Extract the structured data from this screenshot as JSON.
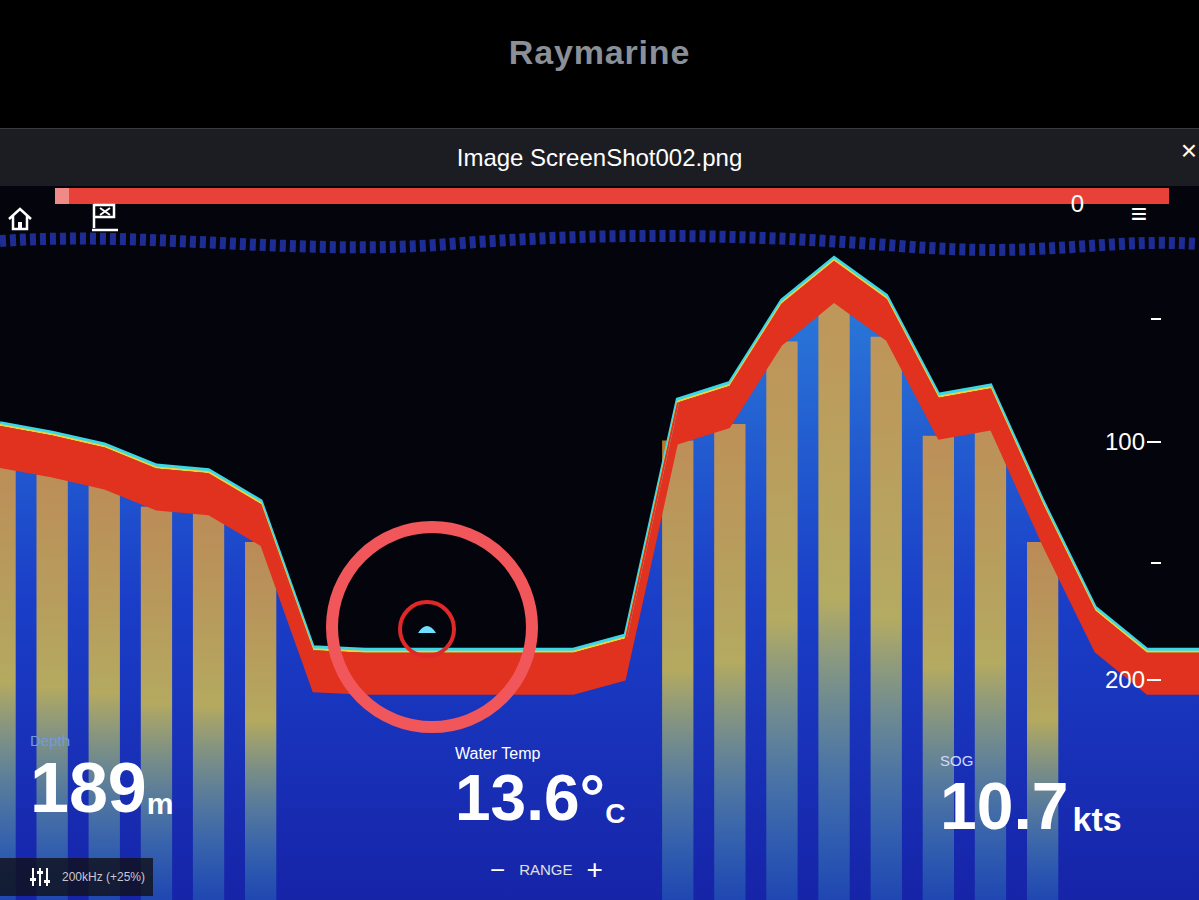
{
  "device": {
    "brand": "Raymarine"
  },
  "window": {
    "title": "Image ScreenShot002.png",
    "close": "×"
  },
  "toolbar": {
    "menu": "≡"
  },
  "sonar": {
    "scale": {
      "ticks": [
        "0",
        "100",
        "200"
      ]
    },
    "frequency": "200kHz (+25%)",
    "bottom_depths": [
      92,
      96,
      101,
      110,
      112,
      125,
      187,
      188,
      188,
      188,
      188,
      188,
      182,
      82,
      75,
      40,
      22,
      38,
      80,
      76,
      125,
      170,
      188,
      188
    ],
    "target": {
      "depth": 178,
      "highlighted": true
    },
    "range": {
      "minus": "−",
      "label": "RANGE",
      "plus": "+"
    }
  },
  "readouts": [
    {
      "label": "Depth",
      "value": "189",
      "unit": "m"
    },
    {
      "label": "Water Temp",
      "value": "13.6°",
      "unit": "C"
    },
    {
      "label": "SOG",
      "value": "10.7",
      "unit": "kts"
    }
  ]
}
